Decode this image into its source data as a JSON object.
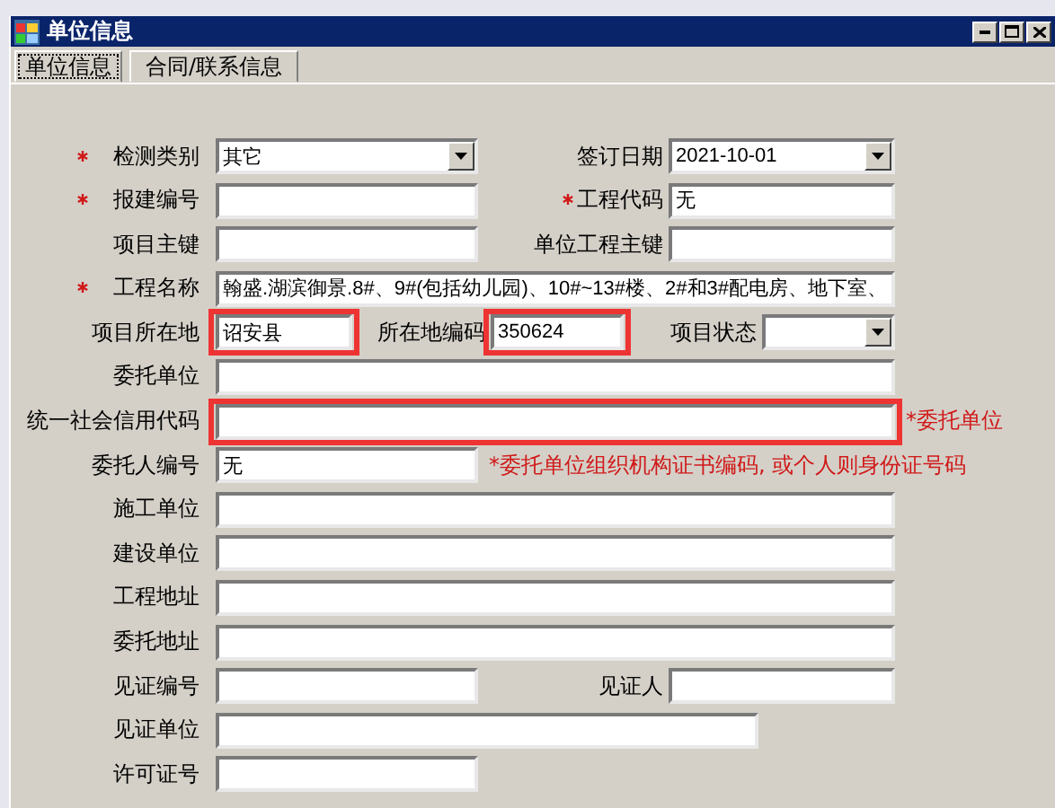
{
  "window": {
    "title": "单位信息"
  },
  "tabs": [
    {
      "label": "单位信息",
      "selected": true
    },
    {
      "label": "合同/联系信息",
      "selected": false
    }
  ],
  "rows": [
    {
      "pairs": [
        {
          "label": "检测类别",
          "required": true,
          "field": {
            "kind": "combo",
            "value": "其它"
          }
        },
        {
          "label": "签订日期",
          "required": false,
          "field": {
            "kind": "combo",
            "value": "2021-10-01"
          }
        }
      ]
    },
    {
      "pairs": [
        {
          "label": "报建编号",
          "required": true,
          "field": {
            "kind": "text"
          }
        },
        {
          "label": "工程代码",
          "required": true,
          "field": {
            "kind": "text",
            "value": "无"
          }
        }
      ]
    },
    {
      "pairs": [
        {
          "label": "项目主键",
          "required": false,
          "field": {
            "kind": "text"
          }
        },
        {
          "label": "单位工程主键",
          "required": false,
          "field": {
            "kind": "text"
          }
        }
      ]
    },
    {
      "pairs": [
        {
          "label": "工程名称",
          "required": true,
          "field": {
            "kind": "text",
            "value": "翰盛.湖滨御景.8#、9#(包括幼儿园)、10#~13#楼、2#和3#配电房、地下室、"
          }
        }
      ]
    },
    {
      "pairs": [
        {
          "label": "项目所在地",
          "required": false,
          "field": {
            "kind": "text",
            "value": "诏安县",
            "highlighted": true
          }
        },
        {
          "label": "所在地编码",
          "required": false,
          "field": {
            "kind": "text",
            "value": "350624",
            "highlighted": true
          }
        },
        {
          "label": "项目状态",
          "required": false,
          "field": {
            "kind": "combo"
          }
        }
      ]
    },
    {
      "pairs": [
        {
          "label": "委托单位",
          "required": false,
          "field": {
            "kind": "text"
          }
        }
      ]
    },
    {
      "pairs": [
        {
          "label": "统一社会信用代码",
          "required": false,
          "field": {
            "kind": "text",
            "highlighted": true
          }
        }
      ],
      "note": "*委托单位"
    },
    {
      "pairs": [
        {
          "label": "委托人编号",
          "required": false,
          "field": {
            "kind": "text",
            "value": "无"
          }
        }
      ],
      "note": "*委托单位组织机构证书编码, 或个人则身份证号码"
    },
    {
      "pairs": [
        {
          "label": "施工单位",
          "required": false,
          "field": {
            "kind": "text"
          }
        }
      ]
    },
    {
      "pairs": [
        {
          "label": "建设单位",
          "required": false,
          "field": {
            "kind": "text"
          }
        }
      ]
    },
    {
      "pairs": [
        {
          "label": "工程地址",
          "required": false,
          "field": {
            "kind": "text"
          }
        }
      ]
    },
    {
      "pairs": [
        {
          "label": "委托地址",
          "required": false,
          "field": {
            "kind": "text"
          }
        }
      ]
    },
    {
      "pairs": [
        {
          "label": "见证编号",
          "required": false,
          "field": {
            "kind": "text"
          }
        },
        {
          "label": "见证人",
          "required": false,
          "field": {
            "kind": "text"
          }
        }
      ]
    },
    {
      "pairs": [
        {
          "label": "见证单位",
          "required": false,
          "field": {
            "kind": "text"
          }
        }
      ]
    },
    {
      "pairs": [
        {
          "label": "许可证号",
          "required": false,
          "field": {
            "kind": "text"
          }
        }
      ]
    }
  ]
}
